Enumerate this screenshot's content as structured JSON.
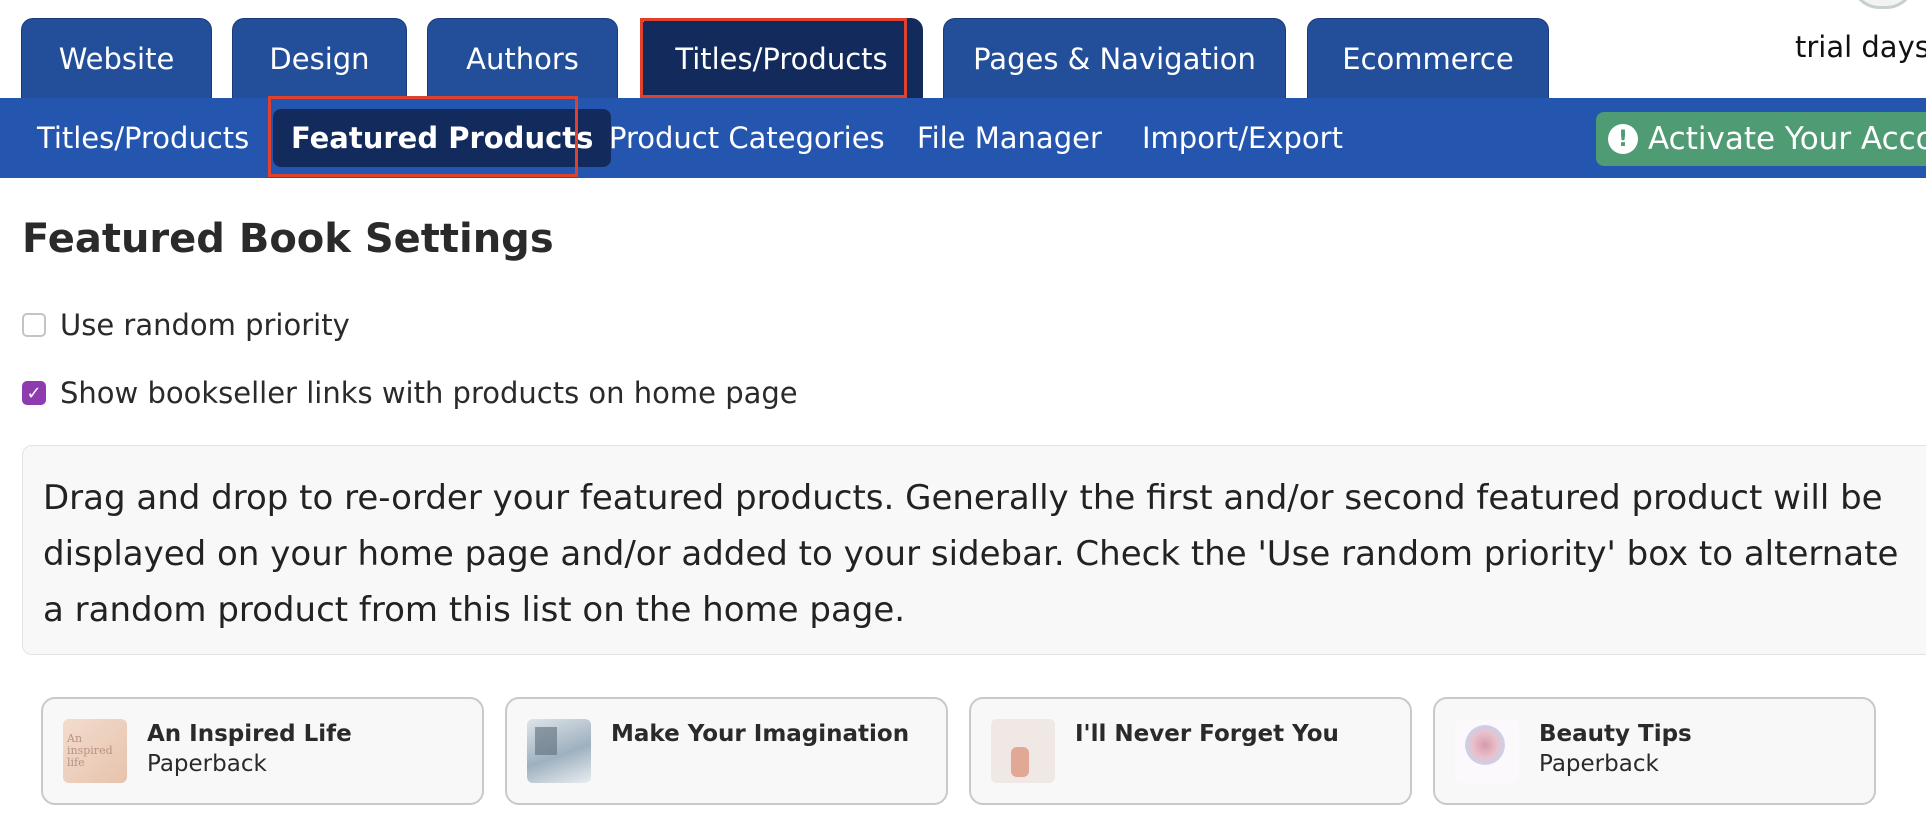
{
  "main_tabs": [
    {
      "label": "Website"
    },
    {
      "label": "Design"
    },
    {
      "label": "Authors"
    },
    {
      "label": "Titles/Products",
      "active": true
    },
    {
      "label": "Pages & Navigation"
    },
    {
      "label": "Ecommerce"
    }
  ],
  "header": {
    "trial_text": "trial days"
  },
  "subnav": {
    "items": [
      {
        "label": "Titles/Products"
      },
      {
        "label": "Featured Products",
        "active": true
      },
      {
        "label": "Product Categories"
      },
      {
        "label": "File Manager"
      },
      {
        "label": "Import/Export"
      }
    ],
    "activate_label": "Activate Your Accou"
  },
  "page": {
    "title": "Featured Book Settings",
    "options": [
      {
        "label": "Use random priority",
        "checked": false
      },
      {
        "label": "Show bookseller links with products on home page",
        "checked": true
      }
    ],
    "notice": "Drag and drop to re-order your featured products. Generally the first and/or second featured product will be displayed on your home page and/or added to your sidebar. Check the 'Use random priority' box to alternate a random product from this list on the home page."
  },
  "products": [
    {
      "title": "An Inspired Life",
      "format": "Paperback",
      "cover_text": "An inspired life"
    },
    {
      "title": "Make Your Imagination",
      "format": ""
    },
    {
      "title": "I'll Never Forget You",
      "format": ""
    },
    {
      "title": "Beauty Tips",
      "format": "Paperback"
    }
  ],
  "colors": {
    "tab_bg": "#234e9a",
    "tab_active_bg": "#132a5c",
    "subnav_bg": "#2456b0",
    "highlight": "#e0402e",
    "activate_bg": "#4f9b73",
    "checkbox_checked": "#8e3bb0"
  }
}
